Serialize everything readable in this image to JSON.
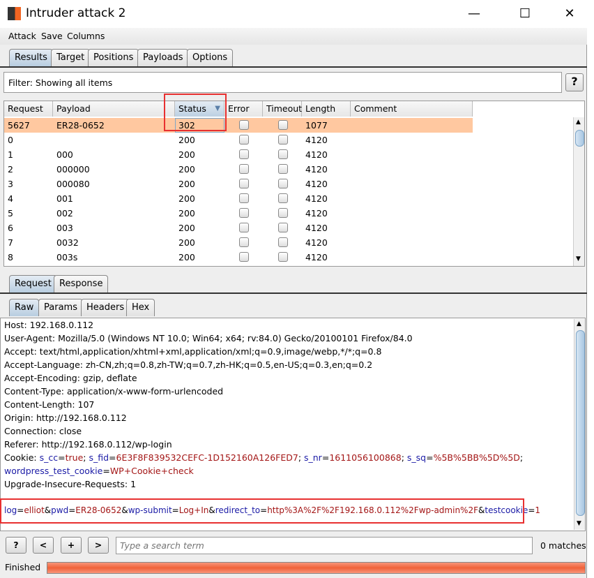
{
  "window": {
    "title": "Intruder attack 2"
  },
  "menu": [
    "Attack",
    "Save",
    "Columns"
  ],
  "tabs": [
    "Results",
    "Target",
    "Positions",
    "Payloads",
    "Options"
  ],
  "filter": {
    "label": "Filter: Showing all items",
    "help": "?"
  },
  "table": {
    "columns": [
      "Request",
      "Payload",
      "Status",
      "Error",
      "Timeout",
      "Length",
      "Comment"
    ],
    "sorted_column": "Status",
    "rows": [
      [
        "5627",
        "ER28-0652",
        "302",
        "",
        "",
        "1077",
        ""
      ],
      [
        "0",
        "",
        "200",
        "",
        "",
        "4120",
        ""
      ],
      [
        "1",
        "000",
        "200",
        "",
        "",
        "4120",
        ""
      ],
      [
        "2",
        "000000",
        "200",
        "",
        "",
        "4120",
        ""
      ],
      [
        "3",
        "000080",
        "200",
        "",
        "",
        "4120",
        ""
      ],
      [
        "4",
        "001",
        "200",
        "",
        "",
        "4120",
        ""
      ],
      [
        "5",
        "002",
        "200",
        "",
        "",
        "4120",
        ""
      ],
      [
        "6",
        "003",
        "200",
        "",
        "",
        "4120",
        ""
      ],
      [
        "7",
        "0032",
        "200",
        "",
        "",
        "4120",
        ""
      ],
      [
        "8",
        "003s",
        "200",
        "",
        "",
        "4120",
        ""
      ]
    ]
  },
  "reqres_tabs": [
    "Request",
    "Response"
  ],
  "view_tabs": [
    "Raw",
    "Params",
    "Headers",
    "Hex"
  ],
  "request_lines": [
    "Host: 192.168.0.112",
    "User-Agent: Mozilla/5.0 (Windows NT 10.0; Win64; x64; rv:84.0) Gecko/20100101 Firefox/84.0",
    "Accept: text/html,application/xhtml+xml,application/xml;q=0.9,image/webp,*/*;q=0.8",
    "Accept-Language: zh-CN,zh;q=0.8,zh-TW;q=0.7,zh-HK;q=0.5,en-US;q=0.3,en;q=0.2",
    "Accept-Encoding: gzip, deflate",
    "Content-Type: application/x-www-form-urlencoded",
    "Content-Length: 107",
    "Origin: http://192.168.0.112",
    "Connection: close",
    "Referer: http://192.168.0.112/wp-login"
  ],
  "cookie": {
    "label": "Cookie: ",
    "pairs": [
      [
        "s_cc",
        "true"
      ],
      [
        "s_fid",
        "6E3F8F839532CEFC-1D152160A126FED7"
      ],
      [
        "s_nr",
        "1611056100868"
      ],
      [
        "s_sq",
        "%5B%5BB%5D%5D"
      ]
    ],
    "pair2": [
      "wordpress_test_cookie",
      "WP+Cookie+check"
    ]
  },
  "upgrade_line": "Upgrade-Insecure-Requests: 1",
  "body_params": [
    [
      "log",
      "elliot"
    ],
    [
      "pwd",
      "ER28-0652"
    ],
    [
      "wp-submit",
      "Log+In"
    ],
    [
      "redirect_to",
      "http%3A%2F%2F192.168.0.112%2Fwp-admin%2F"
    ],
    [
      "testcookie",
      "1"
    ]
  ],
  "search": {
    "placeholder": "Type a search term",
    "matches": "0 matches",
    "buttons": [
      "?",
      "<",
      "+",
      ">"
    ]
  },
  "status": {
    "text": "Finished",
    "progress": 100
  },
  "colors": {
    "highlight_row": "#ffc8a0",
    "annotation": "#e83030",
    "progress": "#f0623a"
  }
}
